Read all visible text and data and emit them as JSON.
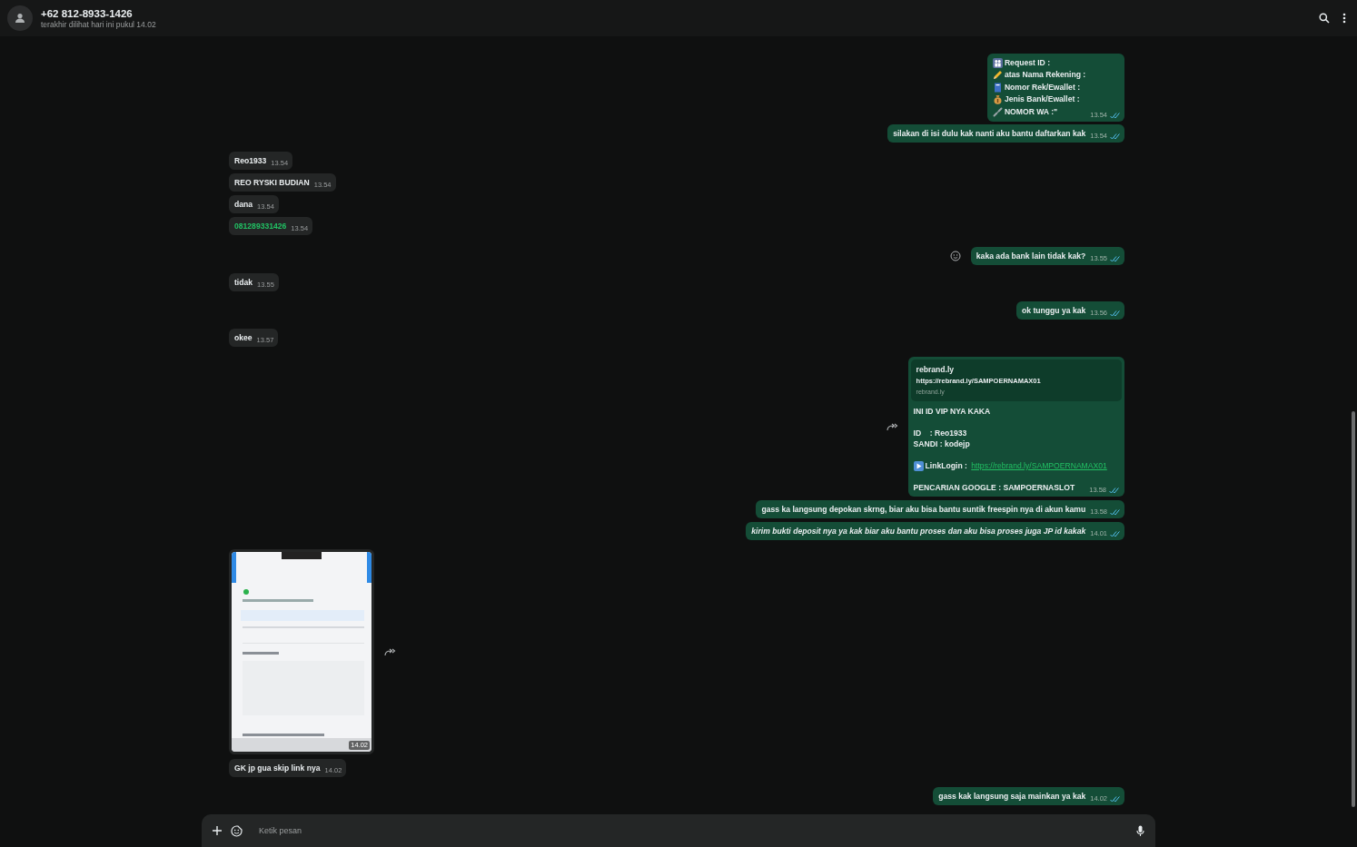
{
  "header": {
    "title": "+62 812-8933-1426",
    "subtitle": "terakhir dilihat hari ini pukul 14.02"
  },
  "messages": [
    {
      "kind": "list",
      "outgoing": true,
      "lines": [
        "Request ID :",
        "atas Nama Rekening :",
        "Nomor Rek/Ewallet :",
        "Jenis Bank/Ewallet :",
        "NOMOR WA :\""
      ],
      "time": "13.54",
      "read": true
    },
    {
      "kind": "text",
      "outgoing": true,
      "text": "silakan di isi dulu kak nanti aku bantu daftarkan kak",
      "time": "13.54",
      "read": true
    },
    {
      "kind": "text",
      "outgoing": false,
      "text": "Reo1933",
      "time": "13.54"
    },
    {
      "kind": "text",
      "outgoing": false,
      "text": "REO RYSKI BUDIAN",
      "time": "13.54"
    },
    {
      "kind": "text",
      "outgoing": false,
      "text": "dana",
      "time": "13.54"
    },
    {
      "kind": "phone",
      "outgoing": false,
      "text": "081289331426",
      "time": "13.54"
    },
    {
      "kind": "text",
      "outgoing": true,
      "text": "kaka ada bank lain tidak kak?",
      "time": "13.55",
      "read": true,
      "react_button": true
    },
    {
      "kind": "text",
      "outgoing": false,
      "text": "tidak",
      "time": "13.55"
    },
    {
      "kind": "text",
      "outgoing": true,
      "text": "ok tunggu ya kak",
      "time": "13.56",
      "read": true
    },
    {
      "kind": "text",
      "outgoing": false,
      "text": "okee",
      "time": "13.57"
    },
    {
      "kind": "link_preview",
      "outgoing": true,
      "preview": {
        "title": "rebrand.ly",
        "url": "https://rebrand.ly/SAMPOERNAMAX01",
        "domain": "rebrand.ly"
      },
      "blocks": [
        {
          "kind": "text",
          "lines": [
            "INI ID VIP NYA KAKA"
          ]
        },
        {
          "kind": "text",
          "lines": [
            "ID    : Reo1933",
            "SANDI : kodejp"
          ]
        },
        {
          "kind": "link",
          "label": "LinkLogin :",
          "url": "https://rebrand.ly/SAMPOERNAMAX01"
        },
        {
          "kind": "text",
          "lines": [
            "PENCARIAN GOOGLE : SAMPOERNASLOT"
          ]
        }
      ],
      "time": "13.58",
      "read": true,
      "forward_button": true
    },
    {
      "kind": "text",
      "outgoing": true,
      "text": "gass ka langsung depokan skrng, biar aku bisa bantu suntik freespin nya di akun kamu",
      "time": "13.58",
      "read": true
    },
    {
      "kind": "text",
      "outgoing": true,
      "text": "kirim bukti deposit nya ya kak biar aku bantu proses dan aku bisa proses juga JP id kakak",
      "time": "14.01",
      "read": true,
      "italic": true
    },
    {
      "outgoing": false,
      "time": "14.02",
      "forward_button": true
    },
    {
      "kind": "text",
      "outgoing": false,
      "text": "GK jp gua skip link nya",
      "time": "14.02"
    },
    {
      "kind": "text",
      "outgoing": true,
      "text": "gass kak langsung saja mainkan ya kak",
      "time": "14.02",
      "read": true
    }
  ],
  "composer": {
    "placeholder": "Ketik pesan"
  }
}
